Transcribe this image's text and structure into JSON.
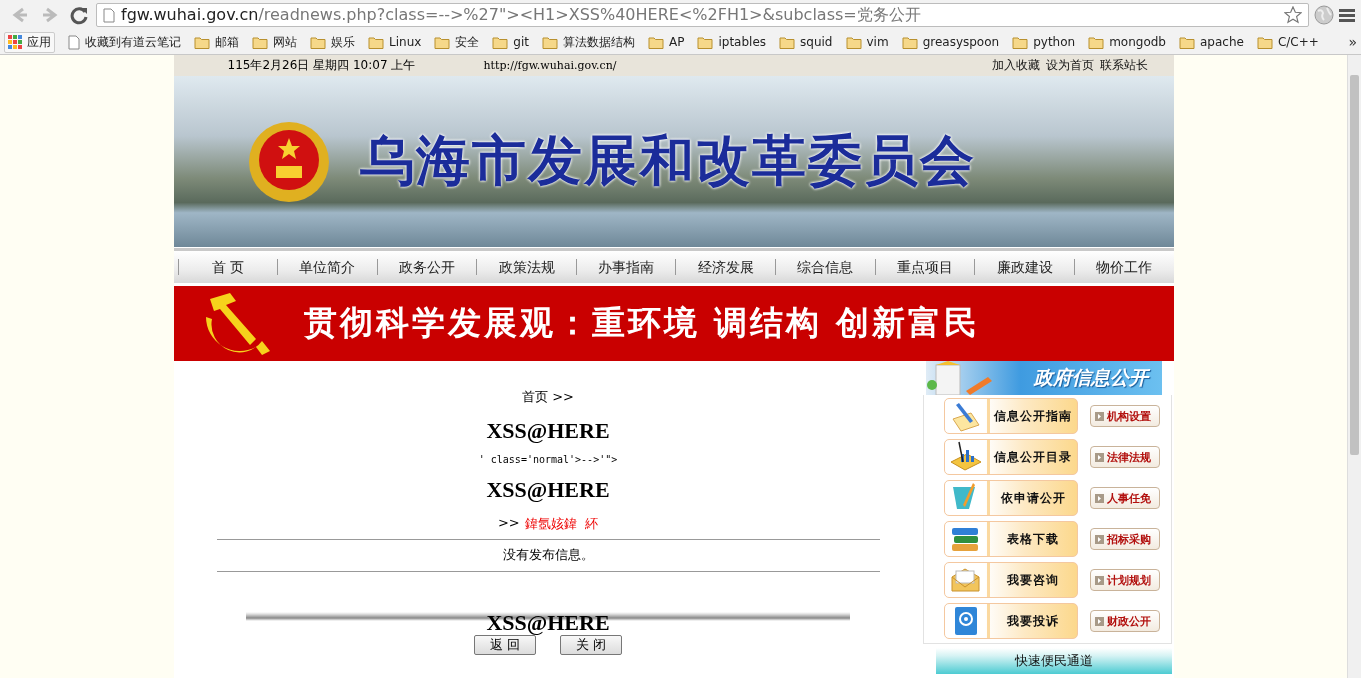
{
  "browser": {
    "nav_buttons": [
      {
        "kind": "back",
        "disabled": true
      },
      {
        "kind": "forward",
        "disabled": true
      },
      {
        "kind": "reload",
        "disabled": false
      }
    ],
    "url_host": "fgw.wuhai.gov.cn",
    "url_rest": "/readnews.php?class=-->%27\"><H1>XSS%40HERE<%2FH1>&subclass=党务公开",
    "bookmarks": [
      {
        "label": "应用",
        "kind": "apps"
      },
      {
        "label": "收藏到有道云笔记",
        "kind": "page"
      },
      {
        "label": "邮箱",
        "kind": "folder"
      },
      {
        "label": "网站",
        "kind": "folder"
      },
      {
        "label": "娱乐",
        "kind": "folder"
      },
      {
        "label": "Linux",
        "kind": "folder"
      },
      {
        "label": "安全",
        "kind": "folder"
      },
      {
        "label": "git",
        "kind": "folder"
      },
      {
        "label": "算法数据结构",
        "kind": "folder"
      },
      {
        "label": "AP",
        "kind": "folder"
      },
      {
        "label": "iptables",
        "kind": "folder"
      },
      {
        "label": "squid",
        "kind": "folder"
      },
      {
        "label": "vim",
        "kind": "folder"
      },
      {
        "label": "greasyspoon",
        "kind": "folder"
      },
      {
        "label": "python",
        "kind": "folder"
      },
      {
        "label": "mongodb",
        "kind": "folder"
      },
      {
        "label": "apache",
        "kind": "folder"
      },
      {
        "label": "C/C++",
        "kind": "folder"
      }
    ],
    "bookmarks_more": "»"
  },
  "top_bar": {
    "date": "115年2月26日 星期四 10:07 上午",
    "url": "http://fgw.wuhai.gov.cn/",
    "links": [
      "加入收藏",
      "设为首页",
      "联系站长"
    ]
  },
  "header": {
    "title": "乌海市发展和改革委员会"
  },
  "nav": [
    "首 页",
    "单位简介",
    "政务公开",
    "政策法规",
    "办事指南",
    "经济发展",
    "综合信息",
    "重点项目",
    "廉政建设",
    "物价工作"
  ],
  "slogan": "贯彻科学发展观：重环境 调结构 创新富民",
  "content": {
    "breadcrumb": "首页 >>",
    "heading_1": "XSS@HERE",
    "injected_text": "' class='normal'>-->'\">",
    "heading_2": "XSS@HERE",
    "crumb_prefix": ">>",
    "crumb_garbled": "鍏氬姟鍏  紑",
    "message": "没有发布信息。",
    "heading_3": "XSS@HERE",
    "buttons": [
      "返 回",
      "关 闭"
    ]
  },
  "sidebar": {
    "title": "政府信息公开",
    "rows": [
      {
        "main": "信息公开指南",
        "side": "机构设置"
      },
      {
        "main": "信息公开目录",
        "side": "法律法规"
      },
      {
        "main": "依申请公开",
        "side": "人事任免"
      },
      {
        "main": "表格下载",
        "side": "招标采购"
      },
      {
        "main": "我要咨询",
        "side": "计划规划"
      },
      {
        "main": "我要投诉",
        "side": "财政公开"
      }
    ],
    "footer": "快速便民通道"
  }
}
